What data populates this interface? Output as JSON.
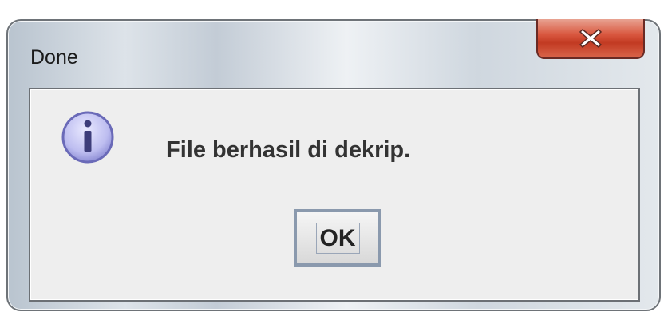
{
  "window": {
    "title": "Done"
  },
  "titlebar": {
    "close_icon": "close-icon"
  },
  "dialog": {
    "icon": "info-icon",
    "message": "File berhasil di dekrip.",
    "ok_label": "OK"
  },
  "colors": {
    "close_button": "#c23a22",
    "content_background": "#eeeeee",
    "info_icon": "#8f8fd6",
    "button_border": "#8a99ad"
  }
}
